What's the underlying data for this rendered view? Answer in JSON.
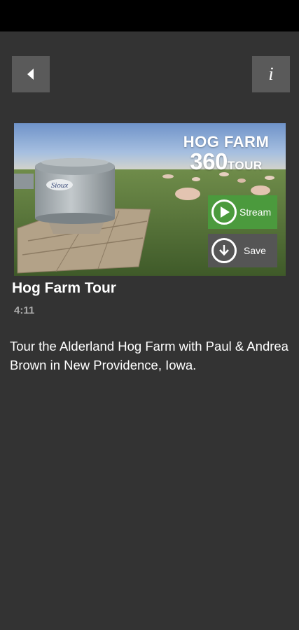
{
  "header": {
    "back_icon": "back-arrow-icon",
    "info_icon": "info-icon",
    "info_glyph": "i"
  },
  "video": {
    "thumbnail_brand_line1": "HOG FARM",
    "thumbnail_brand_line2": "360",
    "thumbnail_brand_line2_suffix": "TOUR",
    "thumbnail_tank_label": "Sioux",
    "title": "Hog Farm Tour",
    "duration": "4:11",
    "description": "Tour the Alderland Hog Farm with Paul & Andrea Brown in New Providence, Iowa."
  },
  "actions": {
    "stream_label": "Stream",
    "stream_icon": "play-circle-icon",
    "save_label": "Save",
    "save_icon": "download-circle-icon"
  },
  "colors": {
    "background": "#333333",
    "stream_button": "#4b9a3d",
    "save_button": "#555555",
    "nav_button": "#5a5a5a"
  }
}
